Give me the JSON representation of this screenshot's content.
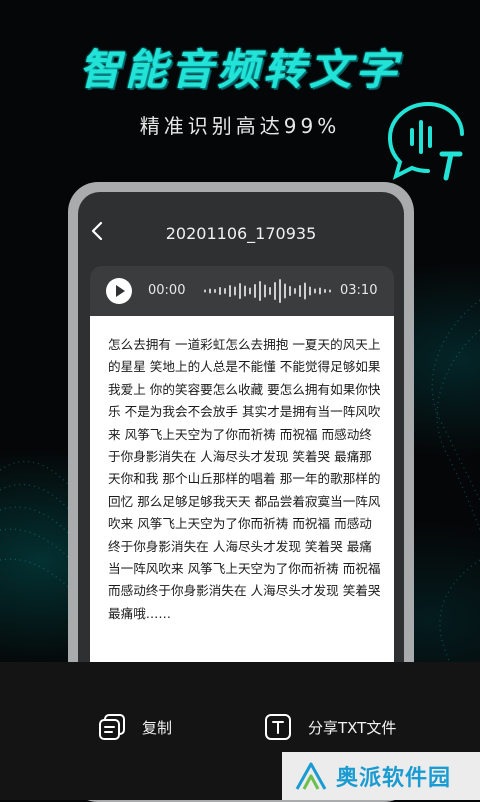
{
  "promo": {
    "headline": "智能音频转文字",
    "subtitle": "精准识别高达99%",
    "accent_color": "#22e3d6",
    "logo_icon": "speech-bubble-sound-text-icon"
  },
  "screen": {
    "back_icon": "chevron-left-icon",
    "file_title": "20201106_170935",
    "player": {
      "play_icon": "play-icon",
      "current_time": "00:00",
      "total_time": "03:10",
      "progress": 0
    },
    "transcript": "怎么去拥有 一道彩虹怎么去拥抱 一夏天的风天上的星星 笑地上的人总是不能懂 不能觉得足够如果我爱上 你的笑容要怎么收藏 要怎么拥有如果你快乐 不是为我会不会放手 其实才是拥有当一阵风吹来 风筝飞上天空为了你而祈祷 而祝福 而感动终于你身影消失在 人海尽头才发现 笑着哭 最痛那天你和我 那个山丘那样的唱着 那一年的歌那样的回忆 那么足够足够我天天 都品尝着寂寞当一阵风吹来 风筝飞上天空为了你而祈祷 而祝福 而感动终于你身影消失在 人海尽头才发现 笑着哭 最痛当一阵风吹来 风筝飞上天空为了你而祈祷 而祝福 而感动终于你身影消失在 人海尽头才发现 笑着哭 最痛哦……"
  },
  "actions": {
    "copy_label": "复制",
    "copy_icon": "copy-icon",
    "share_label": "分享TXT文件",
    "share_icon": "text-file-icon"
  },
  "watermark": {
    "text": "奥派软件园",
    "logo": "aopai-logo",
    "color": "#1a9bd1"
  }
}
